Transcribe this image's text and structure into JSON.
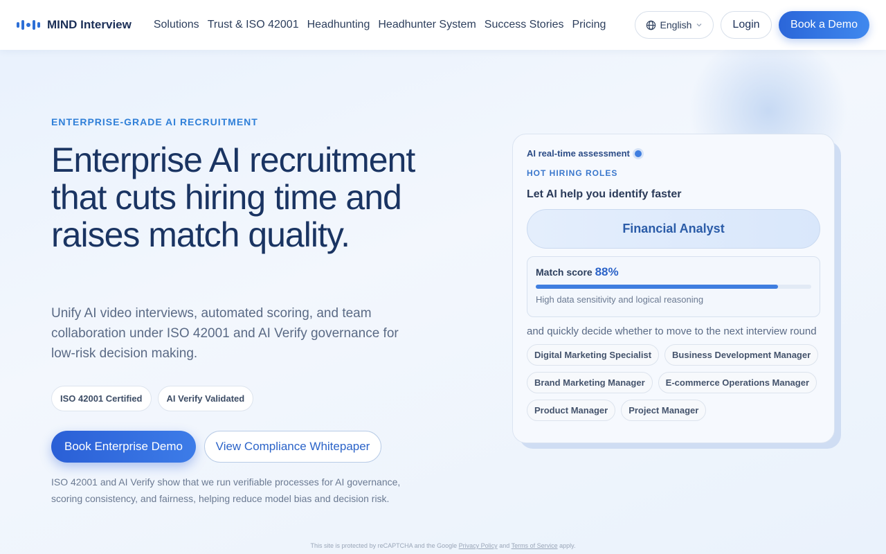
{
  "header": {
    "logo_text": "MIND Interview",
    "nav": [
      {
        "label": "Solutions"
      },
      {
        "label": "Trust & ISO 42001"
      },
      {
        "label": "Headhunting"
      },
      {
        "label": "Headhunter System"
      },
      {
        "label": "Success Stories"
      },
      {
        "label": "Pricing"
      }
    ],
    "language": "English",
    "login": "Login",
    "book_demo": "Book a Demo"
  },
  "hero": {
    "eyebrow": "ENTERPRISE-GRADE AI RECRUITMENT",
    "title": "Enterprise AI recruitment that cuts hiring time and raises match quality.",
    "subtitle": "Unify AI video interviews, automated scoring, and team collaboration under ISO 42001 and AI Verify governance for low-risk decision making.",
    "badges": [
      "ISO 42001 Certified",
      "AI Verify Validated"
    ],
    "cta_primary": "Book Enterprise Demo",
    "cta_secondary": "View Compliance Whitepaper",
    "note": "ISO 42001 and AI Verify show that we run verifiable processes for AI governance, scoring consistency, and fairness, helping reduce model bias and decision risk."
  },
  "card": {
    "live_label": "AI real-time assessment",
    "section_label": "HOT HIRING ROLES",
    "headline": "Let AI help you identify faster",
    "role": "Financial Analyst",
    "match_label": "Match score",
    "match_value": "88%",
    "match_fraction": 0.88,
    "match_desc": "High data sensitivity and logical reasoning",
    "decide_text": "and quickly decide whether to move to the next interview round",
    "roles": [
      "Digital Marketing Specialist",
      "Business Development Manager",
      "Brand Marketing Manager",
      "E-commerce Operations Manager",
      "Product Manager",
      "Project Manager"
    ]
  },
  "footer": {
    "recaptcha_prefix": "This site is protected by reCAPTCHA and the Google",
    "privacy_link": "Privacy Policy",
    "and": "and",
    "terms_link": "Terms of Service",
    "suffix": "apply."
  },
  "colors": {
    "accent": "#2b66d9",
    "eyebrow": "#2f7fd8",
    "title": "#1a3462"
  }
}
